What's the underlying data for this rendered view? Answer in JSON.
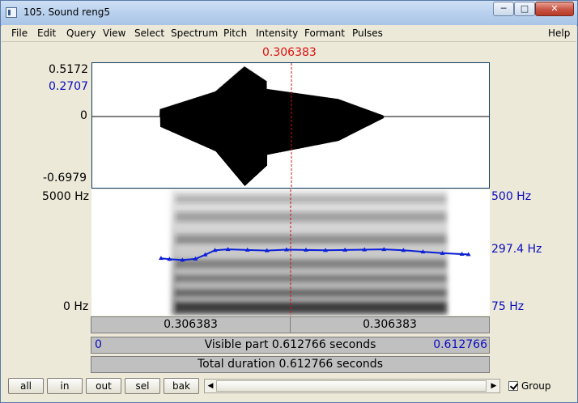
{
  "window": {
    "title": "105. Sound reng5",
    "minimize_glyph": "─",
    "maximize_glyph": "□",
    "close_glyph": "✕"
  },
  "menu": [
    "File",
    "Edit",
    "Query",
    "View",
    "Select",
    "Spectrum",
    "Pitch",
    "Intensity",
    "Formant",
    "Pulses",
    "Help"
  ],
  "cursor": {
    "time_label": "0.306383",
    "time": 0.306383
  },
  "waveform": {
    "top_label": "0.5172",
    "cursor_value_label": "0.2707",
    "zero_label": "0",
    "bottom_label": "-0.6979"
  },
  "spectrogram": {
    "freq_top_label": "5000 Hz",
    "freq_bottom_label": "0 Hz"
  },
  "pitch": {
    "top_label": "500 Hz",
    "value_label": "297.4 Hz",
    "bottom_label": "75 Hz",
    "color": "#0b1fd6",
    "contour": [
      {
        "t": 0.107,
        "hz": 268
      },
      {
        "t": 0.12,
        "hz": 265
      },
      {
        "t": 0.14,
        "hz": 262
      },
      {
        "t": 0.16,
        "hz": 266
      },
      {
        "t": 0.175,
        "hz": 280
      },
      {
        "t": 0.19,
        "hz": 295
      },
      {
        "t": 0.21,
        "hz": 298
      },
      {
        "t": 0.24,
        "hz": 296
      },
      {
        "t": 0.27,
        "hz": 294
      },
      {
        "t": 0.3,
        "hz": 297
      },
      {
        "t": 0.33,
        "hz": 296
      },
      {
        "t": 0.36,
        "hz": 295
      },
      {
        "t": 0.39,
        "hz": 296
      },
      {
        "t": 0.42,
        "hz": 297
      },
      {
        "t": 0.45,
        "hz": 298
      },
      {
        "t": 0.48,
        "hz": 295
      },
      {
        "t": 0.51,
        "hz": 290
      },
      {
        "t": 0.54,
        "hz": 285
      },
      {
        "t": 0.57,
        "hz": 282
      },
      {
        "t": 0.58,
        "hz": 281
      }
    ]
  },
  "time_bar": {
    "left_segment_label": "0.306383",
    "right_segment_label": "0.306383",
    "visible_start": "0",
    "visible_label": "Visible part 0.612766 seconds",
    "visible_end": "0.612766",
    "total_label": "Total duration 0.612766 seconds",
    "visible_duration": 0.612766
  },
  "buttons": [
    "all",
    "in",
    "out",
    "sel",
    "bak"
  ],
  "scrollbar": {
    "left_arrow": "◀",
    "right_arrow": "▶"
  },
  "group_checkbox": {
    "label": "Group",
    "checked": true
  },
  "colors": {
    "cursor": "#cc1111",
    "axis_blue": "#0a0ac0",
    "frame": "#0b3a64"
  }
}
